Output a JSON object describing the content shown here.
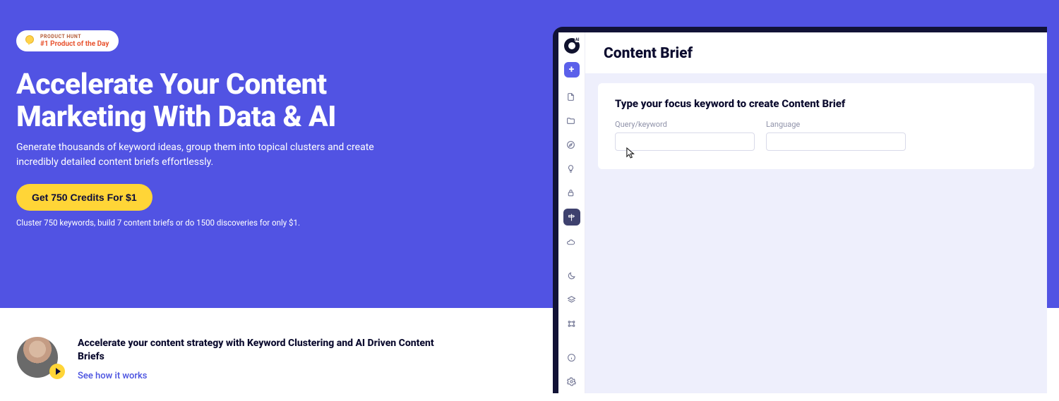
{
  "badge": {
    "hunt_label": "PRODUCT HUNT",
    "subtitle": "#1 Product of the Day"
  },
  "hero": {
    "headline_line1": "Accelerate Your Content",
    "headline_line2": "Marketing With Data & AI",
    "subhead": "Generate thousands of keyword ideas, group them into topical clusters and create incredibly detailed content briefs effortlessly.",
    "cta_label": "Get 750 Credits For $1",
    "cta_sub": "Cluster 750 keywords, build 7 content briefs or do 1500 discoveries for only $1."
  },
  "testimonial": {
    "title": "Accelerate your content strategy with Keyword Clustering and AI Driven Content Briefs",
    "link_label": "See how it works"
  },
  "app": {
    "title": "Content Brief",
    "brief": {
      "heading": "Type your focus keyword to create Content Brief",
      "keyword_label": "Query/keyword",
      "keyword_value": "",
      "language_label": "Language",
      "language_value": ""
    },
    "sidebar": {
      "add_label": "+"
    }
  }
}
